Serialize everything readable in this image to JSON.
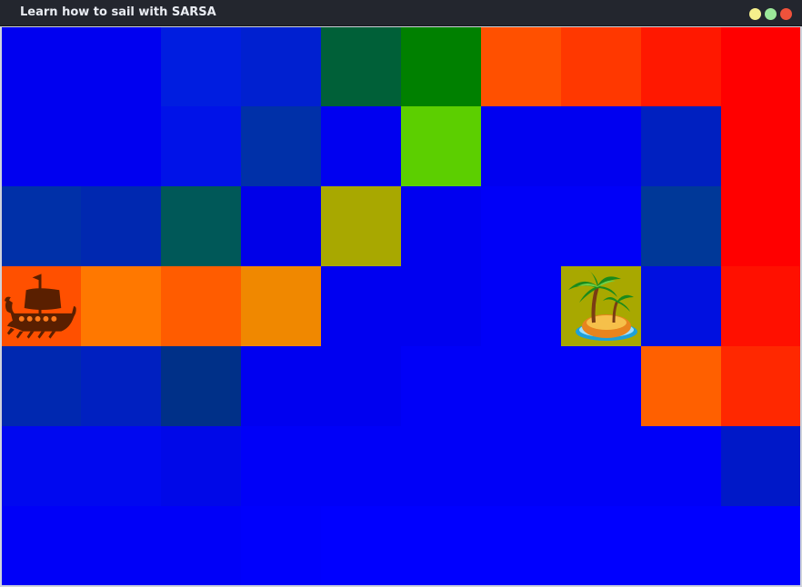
{
  "window": {
    "title": "Learn how to sail with SARSA"
  },
  "grid": {
    "rows": 7,
    "cols": 10,
    "colors": [
      [
        "#0000f0",
        "#0000f0",
        "#001de0",
        "#0020d0",
        "#006038",
        "#008000",
        "#ff5000",
        "#ff3800",
        "#ff1800",
        "#ff0000"
      ],
      [
        "#0000f0",
        "#0000f0",
        "#0012e8",
        "#0030a8",
        "#0000f0",
        "#5ccf00",
        "#0000f0",
        "#0000f0",
        "#0020c0",
        "#ff0000"
      ],
      [
        "#0030a8",
        "#0028b0",
        "#005858",
        "#0000e8",
        "#a8a800",
        "#0000f0",
        "#0000f8",
        "#0000f8",
        "#003898",
        "#ff0000"
      ],
      [
        "#ff5000",
        "#ff7800",
        "#ff5c00",
        "#f08800",
        "#0000f0",
        "#0000f0",
        "#0000f8",
        "#a8a800",
        "#0010e0",
        "#ff1000"
      ],
      [
        "#0028b0",
        "#0020c0",
        "#003088",
        "#0000f0",
        "#0000f0",
        "#0000f8",
        "#0000f8",
        "#0000f8",
        "#ff6000",
        "#ff2800"
      ],
      [
        "#0008f0",
        "#0008f0",
        "#0008e8",
        "#0000f8",
        "#0000f8",
        "#0000f8",
        "#0000f8",
        "#0000f8",
        "#0000f8",
        "#0018c8"
      ],
      [
        "#0000f8",
        "#0000f8",
        "#0000f8",
        "#0000fc",
        "#0000ff",
        "#0000ff",
        "#0000ff",
        "#0000ff",
        "#0000ff",
        "#0000ff"
      ]
    ],
    "agent": {
      "row": 3,
      "col": 0,
      "icon": "viking-ship-icon"
    },
    "goal": {
      "row": 3,
      "col": 7,
      "icon": "palm-island-icon"
    }
  }
}
